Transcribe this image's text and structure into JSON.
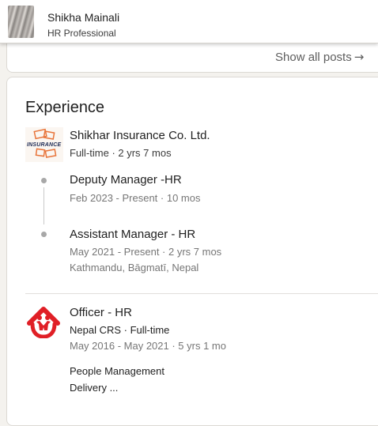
{
  "header": {
    "name": "Shikha Mainali",
    "headline": "HR Professional"
  },
  "posts": {
    "show_all_label": "Show all posts",
    "arrow_icon": "arrow-right-icon"
  },
  "experience": {
    "title": "Experience",
    "entries": [
      {
        "company": "Shikhar Insurance Co. Ltd.",
        "logo_text": "INSURANCE",
        "summary": "Full-time · 2 yrs 7 mos",
        "roles": [
          {
            "title": "Deputy Manager -HR",
            "dates": "Feb 2023 - Present · 10 mos"
          },
          {
            "title": "Assistant Manager - HR",
            "dates": "May 2021 - Present · 2 yrs 7 mos",
            "location": "Kathmandu, Bāgmatī, Nepal"
          }
        ]
      },
      {
        "title": "Officer - HR",
        "company_line": "Nepal CRS · Full-time",
        "dates": "May 2016 - May 2021 · 5 yrs 1 mo",
        "skills": "People Management",
        "description": "Delivery ..."
      }
    ]
  },
  "colors": {
    "page_bg": "#f4f2ee",
    "card_bg": "#ffffff",
    "logo_red": "#e01f26",
    "secondary_text": "#767676"
  }
}
